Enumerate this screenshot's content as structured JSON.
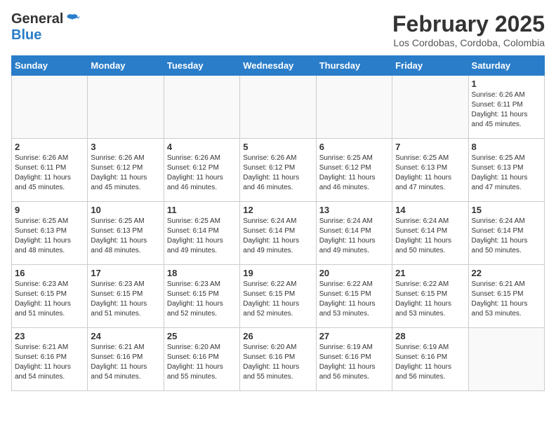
{
  "header": {
    "logo_general": "General",
    "logo_blue": "Blue",
    "month_year": "February 2025",
    "location": "Los Cordobas, Cordoba, Colombia"
  },
  "weekdays": [
    "Sunday",
    "Monday",
    "Tuesday",
    "Wednesday",
    "Thursday",
    "Friday",
    "Saturday"
  ],
  "weeks": [
    [
      {
        "day": "",
        "info": ""
      },
      {
        "day": "",
        "info": ""
      },
      {
        "day": "",
        "info": ""
      },
      {
        "day": "",
        "info": ""
      },
      {
        "day": "",
        "info": ""
      },
      {
        "day": "",
        "info": ""
      },
      {
        "day": "1",
        "info": "Sunrise: 6:26 AM\nSunset: 6:11 PM\nDaylight: 11 hours\nand 45 minutes."
      }
    ],
    [
      {
        "day": "2",
        "info": "Sunrise: 6:26 AM\nSunset: 6:11 PM\nDaylight: 11 hours\nand 45 minutes."
      },
      {
        "day": "3",
        "info": "Sunrise: 6:26 AM\nSunset: 6:12 PM\nDaylight: 11 hours\nand 45 minutes."
      },
      {
        "day": "4",
        "info": "Sunrise: 6:26 AM\nSunset: 6:12 PM\nDaylight: 11 hours\nand 46 minutes."
      },
      {
        "day": "5",
        "info": "Sunrise: 6:26 AM\nSunset: 6:12 PM\nDaylight: 11 hours\nand 46 minutes."
      },
      {
        "day": "6",
        "info": "Sunrise: 6:25 AM\nSunset: 6:12 PM\nDaylight: 11 hours\nand 46 minutes."
      },
      {
        "day": "7",
        "info": "Sunrise: 6:25 AM\nSunset: 6:13 PM\nDaylight: 11 hours\nand 47 minutes."
      },
      {
        "day": "8",
        "info": "Sunrise: 6:25 AM\nSunset: 6:13 PM\nDaylight: 11 hours\nand 47 minutes."
      }
    ],
    [
      {
        "day": "9",
        "info": "Sunrise: 6:25 AM\nSunset: 6:13 PM\nDaylight: 11 hours\nand 48 minutes."
      },
      {
        "day": "10",
        "info": "Sunrise: 6:25 AM\nSunset: 6:13 PM\nDaylight: 11 hours\nand 48 minutes."
      },
      {
        "day": "11",
        "info": "Sunrise: 6:25 AM\nSunset: 6:14 PM\nDaylight: 11 hours\nand 49 minutes."
      },
      {
        "day": "12",
        "info": "Sunrise: 6:24 AM\nSunset: 6:14 PM\nDaylight: 11 hours\nand 49 minutes."
      },
      {
        "day": "13",
        "info": "Sunrise: 6:24 AM\nSunset: 6:14 PM\nDaylight: 11 hours\nand 49 minutes."
      },
      {
        "day": "14",
        "info": "Sunrise: 6:24 AM\nSunset: 6:14 PM\nDaylight: 11 hours\nand 50 minutes."
      },
      {
        "day": "15",
        "info": "Sunrise: 6:24 AM\nSunset: 6:14 PM\nDaylight: 11 hours\nand 50 minutes."
      }
    ],
    [
      {
        "day": "16",
        "info": "Sunrise: 6:23 AM\nSunset: 6:15 PM\nDaylight: 11 hours\nand 51 minutes."
      },
      {
        "day": "17",
        "info": "Sunrise: 6:23 AM\nSunset: 6:15 PM\nDaylight: 11 hours\nand 51 minutes."
      },
      {
        "day": "18",
        "info": "Sunrise: 6:23 AM\nSunset: 6:15 PM\nDaylight: 11 hours\nand 52 minutes."
      },
      {
        "day": "19",
        "info": "Sunrise: 6:22 AM\nSunset: 6:15 PM\nDaylight: 11 hours\nand 52 minutes."
      },
      {
        "day": "20",
        "info": "Sunrise: 6:22 AM\nSunset: 6:15 PM\nDaylight: 11 hours\nand 53 minutes."
      },
      {
        "day": "21",
        "info": "Sunrise: 6:22 AM\nSunset: 6:15 PM\nDaylight: 11 hours\nand 53 minutes."
      },
      {
        "day": "22",
        "info": "Sunrise: 6:21 AM\nSunset: 6:15 PM\nDaylight: 11 hours\nand 53 minutes."
      }
    ],
    [
      {
        "day": "23",
        "info": "Sunrise: 6:21 AM\nSunset: 6:16 PM\nDaylight: 11 hours\nand 54 minutes."
      },
      {
        "day": "24",
        "info": "Sunrise: 6:21 AM\nSunset: 6:16 PM\nDaylight: 11 hours\nand 54 minutes."
      },
      {
        "day": "25",
        "info": "Sunrise: 6:20 AM\nSunset: 6:16 PM\nDaylight: 11 hours\nand 55 minutes."
      },
      {
        "day": "26",
        "info": "Sunrise: 6:20 AM\nSunset: 6:16 PM\nDaylight: 11 hours\nand 55 minutes."
      },
      {
        "day": "27",
        "info": "Sunrise: 6:19 AM\nSunset: 6:16 PM\nDaylight: 11 hours\nand 56 minutes."
      },
      {
        "day": "28",
        "info": "Sunrise: 6:19 AM\nSunset: 6:16 PM\nDaylight: 11 hours\nand 56 minutes."
      },
      {
        "day": "",
        "info": ""
      }
    ]
  ]
}
